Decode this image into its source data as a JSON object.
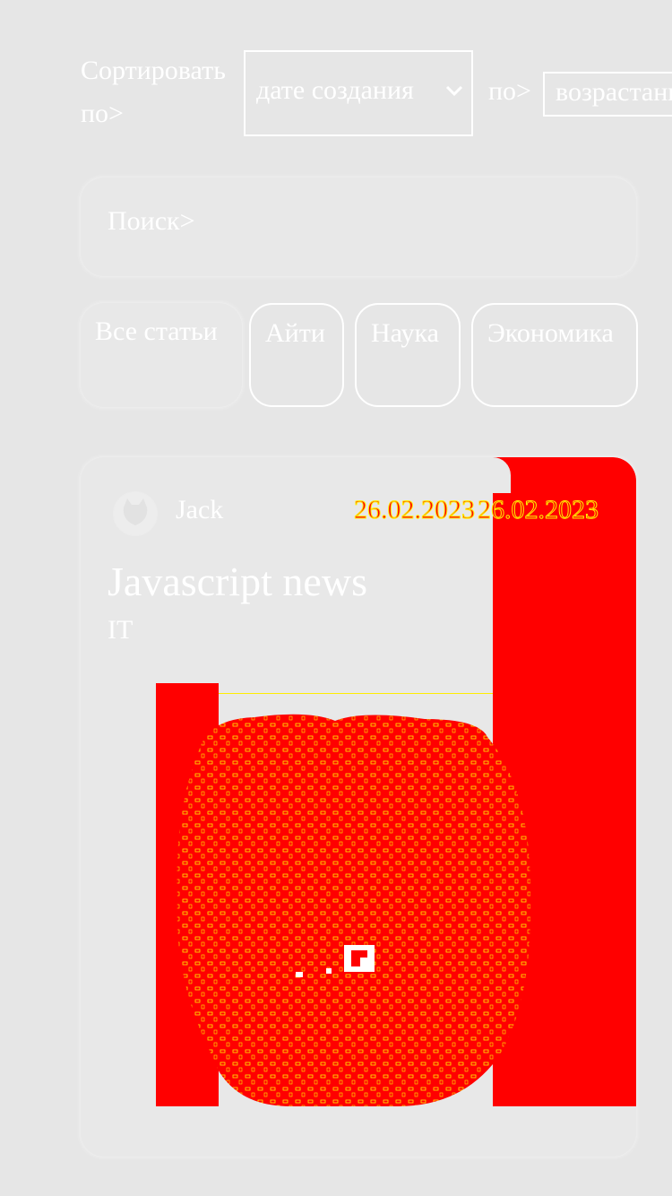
{
  "sort": {
    "label": "Сортировать по>",
    "field_value": "дате создания",
    "by_label": "по>",
    "order_value": "возрастанию"
  },
  "search": {
    "placeholder": "Поиск>"
  },
  "categories": [
    {
      "label": "Все статьи",
      "active": true
    },
    {
      "label": "Айти",
      "active": false
    },
    {
      "label": "Наука",
      "active": false
    },
    {
      "label": "Экономика",
      "active": false
    }
  ],
  "article": {
    "author": "Jack",
    "date_primary": "26.02.2023",
    "date_secondary": "26.02.2023",
    "title": "Javascript news",
    "tag": "IT",
    "image_icon": "cat-image"
  },
  "colors": {
    "background": "#e6e6e6",
    "accent": "#ff0000",
    "outline": "#ffee00",
    "text": "#ffffff"
  }
}
